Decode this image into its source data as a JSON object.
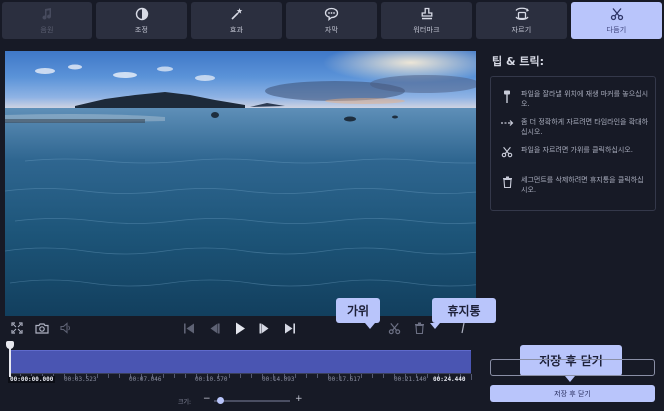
{
  "tabs": [
    {
      "label": "음원",
      "icon": "music-note-icon",
      "state": "disabled"
    },
    {
      "label": "조정",
      "icon": "contrast-icon",
      "state": "normal"
    },
    {
      "label": "효과",
      "icon": "magic-wand-icon",
      "state": "normal"
    },
    {
      "label": "자막",
      "icon": "speech-bubble-icon",
      "state": "normal"
    },
    {
      "label": "워터마크",
      "icon": "stamp-icon",
      "state": "normal"
    },
    {
      "label": "자르기",
      "icon": "crop-icon",
      "state": "normal"
    },
    {
      "label": "다듬기",
      "icon": "scissors-icon",
      "state": "active"
    }
  ],
  "tips": {
    "title": "팁 & 트릭:",
    "items": [
      {
        "icon": "marker-pin-icon",
        "text": "파일을 잘라낼 위치에 재생 마커를 놓으십시오."
      },
      {
        "icon": "arrow-right-icon",
        "text": "좀 더 정확하게 자르려면 타임라인을 확대하십시오."
      },
      {
        "icon": "scissors-icon",
        "text": "파일을 자르려면 가위를 클릭하십시오."
      },
      {
        "icon": "trash-icon",
        "text": "세그먼트를 삭제하려면 휴지통을 클릭하십시오."
      }
    ]
  },
  "callouts": {
    "scissors": "가위",
    "trash": "휴지통",
    "save_close": "저장 후 닫기"
  },
  "timeline": {
    "current": "00:00:00.000",
    "end": "00:24.440",
    "ticks": [
      "00:03.523",
      "00:07.046",
      "00:10.570",
      "00:14.093",
      "00:17.617",
      "00:21.140"
    ],
    "playhead_fraction": 0
  },
  "zoom": {
    "label": "크기:",
    "minus": "−",
    "plus": "+",
    "level": 0.05
  },
  "save_button": "저장 후 닫기",
  "colors": {
    "accent": "#b9c5fb",
    "track": "#4a55b2",
    "background": "#171a26"
  }
}
